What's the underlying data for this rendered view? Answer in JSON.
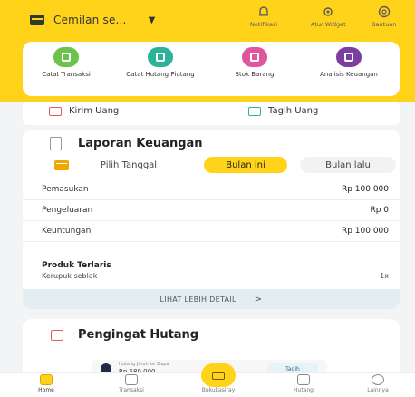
{
  "header": {
    "store_name": "Cemilan se...",
    "actions": [
      {
        "label": "Notifikasi",
        "icon": "bell-icon"
      },
      {
        "label": "Atur Widget",
        "icon": "widget-settings-icon"
      },
      {
        "label": "Bantuan",
        "icon": "help-icon"
      }
    ]
  },
  "quick_actions": [
    {
      "label": "Catat Transaksi",
      "icon": "record-transaction-icon",
      "color": "#6cc24a"
    },
    {
      "label": "Catat Hutang Piutang",
      "icon": "record-debt-icon",
      "color": "#2bb39a"
    },
    {
      "label": "Stok Barang",
      "icon": "stock-icon",
      "color": "#e0559f"
    },
    {
      "label": "Analisis Keuangan",
      "icon": "analysis-icon",
      "color": "#7b3fa0"
    }
  ],
  "transfer": {
    "send_label": "Kirim Uang",
    "bill_label": "Tagih Uang"
  },
  "report": {
    "title": "Laporan Keuangan",
    "filters": {
      "pick_date": "Pilih Tanggal",
      "this_month": "Bulan ini",
      "last_month": "Bulan lalu"
    },
    "rows": [
      {
        "label": "Pemasukan",
        "value": "Rp 100.000"
      },
      {
        "label": "Pengeluaran",
        "value": "Rp 0"
      },
      {
        "label": "Keuntungan",
        "value": "Rp 100.000"
      }
    ],
    "top_product_title": "Produk Terlaris",
    "top_product_name": "Kerupuk seblak",
    "top_product_qty": "1x",
    "more_label": "LIHAT LEBIH DETAIL",
    "more_arrow": ">"
  },
  "debt": {
    "title": "Pengingat Hutang",
    "card_sub": "Hutang Jatuh ke Siapa",
    "card_amount": "Rp 580.000",
    "card_button": "Tagih"
  },
  "bottom_nav": {
    "items": [
      {
        "label": "Home",
        "icon": "home-icon",
        "active": true
      },
      {
        "label": "Transaksi",
        "icon": "transaction-icon",
        "active": false
      },
      {
        "label": "Bukukasiray",
        "icon": "pos-icon",
        "active": false
      },
      {
        "label": "Hutang",
        "icon": "debt-icon",
        "active": false
      },
      {
        "label": "Lainnya",
        "icon": "more-icon",
        "active": false
      }
    ]
  },
  "colors": {
    "accent": "#ffd31a",
    "background": "#f3f4f6"
  }
}
